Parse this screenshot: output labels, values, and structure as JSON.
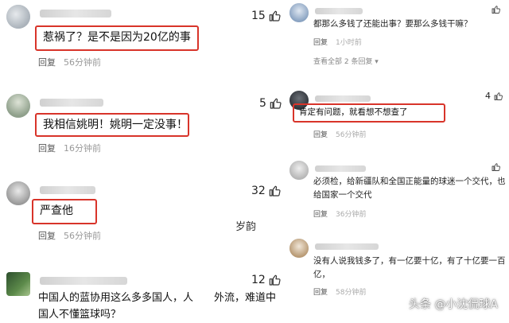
{
  "left_comments": [
    {
      "likes": "15",
      "text": "惹祸了？是不是因为20亿的事",
      "reply": "回复",
      "time": "56分钟前"
    },
    {
      "likes": "5",
      "text": "我相信姚明！姚明一定没事！",
      "reply": "回复",
      "time": "16分钟前"
    },
    {
      "likes": "32",
      "text": "严查他",
      "reply": "回复",
      "time": "56分钟前"
    },
    {
      "likes": "12",
      "text": "中国人的蓝协用这么多多国人，人　　外流，难道中",
      "text2": "国人不懂篮球吗？"
    }
  ],
  "overlay_word": "岁韵",
  "right_comments": [
    {
      "likes": "",
      "text": "都那么多钱了还能出事？要那么多钱干嘛？",
      "reply": "回复",
      "time": "1小时前",
      "see_all": "查看全部 2 条回复 ▾"
    },
    {
      "likes": "4",
      "text": "肯定有问题，就看想不想查了",
      "reply": "回复",
      "time": "56分钟前"
    },
    {
      "likes": "",
      "text": "必须检，给新疆队和全国正能量的球迷一个交代，也",
      "text2": "给国家一个交代",
      "reply": "回复",
      "time": "36分钟前"
    },
    {
      "likes": "",
      "text": "没有人说我钱多了，有一亿要十亿，有了十亿要一百",
      "text2": "亿，",
      "reply": "回复",
      "time": "58分钟前"
    }
  ],
  "watermark": "头条 @小沈侃球A",
  "colors": {
    "highlight_border": "#d8342a",
    "meta_text": "#555555",
    "time_text": "#999999"
  },
  "icons": {
    "like": "thumbs-up-icon"
  }
}
